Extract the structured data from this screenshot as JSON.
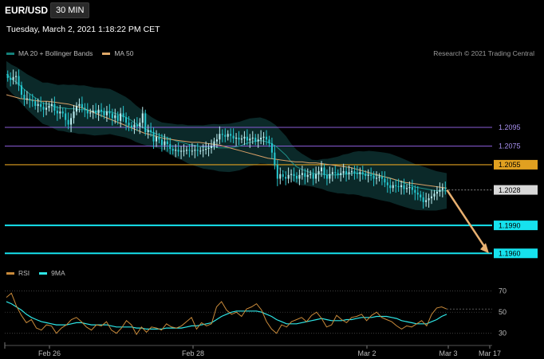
{
  "header": {
    "symbol": "EUR/USD",
    "interval": "30 MIN"
  },
  "datetime": "Tuesday, March 2, 2021 1:18:22 PM CET",
  "legend_top": [
    {
      "label": "MA 20 + Bollinger Bands",
      "color": "#14807a"
    },
    {
      "label": "MA 50",
      "color": "#e0a868"
    }
  ],
  "legend_rsi": [
    {
      "label": "RSI",
      "color": "#c98a3a"
    },
    {
      "label": "9MA",
      "color": "#2ee6e6"
    }
  ],
  "credit": "Research © 2021 Trading Central",
  "colors": {
    "up": "#bdeff2",
    "down": "#25c8d0",
    "level_gold": "#e0a020",
    "level_purple": "#8a5cd6",
    "level_cyan": "#16e2ee",
    "arrow": "#e8b070"
  },
  "chart_data": [
    {
      "type": "candlestick",
      "ylim": [
        1.195,
        1.2165
      ],
      "series": [
        {
          "name": "Price",
          "values": [
            1.2148,
            1.2146,
            1.2149,
            1.215,
            1.214,
            1.213,
            1.2125,
            1.2126,
            1.2124,
            1.2123,
            1.2118,
            1.212,
            1.2117,
            1.2114,
            1.2116,
            1.2118,
            1.212,
            1.2113,
            1.211,
            1.2112,
            1.211,
            1.2103,
            1.2098,
            1.2105,
            1.2112,
            1.2118,
            1.212,
            1.2116,
            1.2114,
            1.211,
            1.2111,
            1.2113,
            1.211,
            1.2114,
            1.2112,
            1.2108,
            1.2112,
            1.211,
            1.2105,
            1.2108,
            1.2102,
            1.211,
            1.2106,
            1.21,
            1.2097,
            1.2095,
            1.2098,
            1.2096,
            1.21,
            1.211,
            1.209,
            1.2092,
            1.209,
            1.208,
            1.2085,
            1.2082,
            1.2076,
            1.208,
            1.2077,
            1.2072,
            1.207,
            1.2071,
            1.2069,
            1.207,
            1.207,
            1.2071,
            1.207,
            1.207,
            1.2071,
            1.207,
            1.207,
            1.2071,
            1.2072,
            1.2073,
            1.2075,
            1.208,
            1.2082,
            1.2088,
            1.2087,
            1.2085,
            1.2088,
            1.2086,
            1.2083,
            1.2084,
            1.2082,
            1.2083,
            1.2085,
            1.2081,
            1.2083,
            1.2084,
            1.208,
            1.2082,
            1.2084,
            1.2085,
            1.2082,
            1.2078,
            1.2068,
            1.2055,
            1.204,
            1.2045,
            1.2042,
            1.204,
            1.2044,
            1.2045,
            1.2043,
            1.204,
            1.2044,
            1.2046,
            1.2042,
            1.2044,
            1.2045,
            1.204,
            1.2045,
            1.2048,
            1.2052,
            1.2044,
            1.204,
            1.2045,
            1.2047,
            1.2046,
            1.2044,
            1.2046,
            1.2048,
            1.2045,
            1.2047,
            1.2048,
            1.2046,
            1.2045,
            1.2047,
            1.2045,
            1.2043,
            1.2044,
            1.2043,
            1.204,
            1.2041,
            1.2042,
            1.204,
            1.2036,
            1.2033,
            1.203,
            1.2033,
            1.2032,
            1.2031,
            1.2033,
            1.2029,
            1.203,
            1.2031,
            1.2028,
            1.2025,
            1.2023,
            1.202,
            1.2015,
            1.2017,
            1.2019,
            1.2021,
            1.2024,
            1.2026,
            1.2028,
            1.203,
            1.2029
          ]
        },
        {
          "name": "MA 20",
          "values": [
            1.2152,
            1.2147,
            1.2143,
            1.2138,
            1.2133,
            1.2129,
            1.2125,
            1.2121,
            1.212,
            1.2118,
            1.2116,
            1.2116,
            1.2115,
            1.2115,
            1.2114,
            1.2114,
            1.2113,
            1.2112,
            1.2112,
            1.2112,
            1.2112,
            1.211,
            1.2108,
            1.2106,
            1.2103,
            1.2099,
            1.2096,
            1.2093,
            1.209,
            1.2088,
            1.2086,
            1.2084,
            1.2082,
            1.208,
            1.2079,
            1.2077,
            1.2076,
            1.2075,
            1.2074,
            1.2074,
            1.2074,
            1.2073,
            1.2073,
            1.2073,
            1.2074,
            1.2075,
            1.2077,
            1.2079,
            1.208,
            1.2081,
            1.208,
            1.2078,
            1.2075,
            1.207,
            1.2065,
            1.2058,
            1.2053,
            1.205,
            1.2048,
            1.2046,
            1.2045,
            1.2045,
            1.2044,
            1.2044,
            1.2044,
            1.2045,
            1.2045,
            1.2046,
            1.2046,
            1.2045,
            1.2045,
            1.2044,
            1.2043,
            1.2042,
            1.2041,
            1.2039,
            1.2037,
            1.2035,
            1.2033,
            1.2031,
            1.203,
            1.2029,
            1.2028,
            1.2027,
            1.2027,
            1.2027
          ]
        },
        {
          "name": "MA 50",
          "values": [
            1.213,
            1.2128,
            1.2126,
            1.2125,
            1.2124,
            1.2123,
            1.2123,
            1.2122,
            1.2121,
            1.212,
            1.2118,
            1.2116,
            1.2113,
            1.211,
            1.2107,
            1.2104,
            1.2101,
            1.2098,
            1.2095,
            1.2092,
            1.2089,
            1.2087,
            1.2085,
            1.2083,
            1.2082,
            1.2081,
            1.208,
            1.2079,
            1.2079,
            1.2078,
            1.2077,
            1.2076,
            1.2074,
            1.2072,
            1.207,
            1.2068,
            1.2066,
            1.2064,
            1.2062,
            1.2061,
            1.206,
            1.2059,
            1.2058,
            1.2058,
            1.2057,
            1.2057,
            1.2056,
            1.2055,
            1.2054,
            1.2053,
            1.2052,
            1.205,
            1.2048,
            1.2046,
            1.2044,
            1.2042,
            1.204,
            1.2038,
            1.2036,
            1.2035,
            1.2034,
            1.2033,
            1.2032,
            1.2031,
            1.203
          ]
        }
      ],
      "levels": [
        {
          "value": 1.2095,
          "label": "1.2095",
          "style": "purple"
        },
        {
          "value": 1.2075,
          "label": "1.2075",
          "style": "purple"
        },
        {
          "value": 1.2055,
          "label": "1.2055",
          "style": "gold"
        },
        {
          "value": 1.2028,
          "label": "1.2028",
          "style": "current"
        },
        {
          "value": 1.199,
          "label": "1.1990",
          "style": "cyan"
        },
        {
          "value": 1.196,
          "label": "1.1960",
          "style": "cyan"
        }
      ],
      "forecast_arrow": {
        "from": 1.2028,
        "to": 1.196
      }
    },
    {
      "type": "line",
      "ylim": [
        20,
        78
      ],
      "yticks": [
        70,
        50,
        30
      ],
      "series": [
        {
          "name": "RSI",
          "values": [
            64,
            68,
            56,
            47,
            40,
            43,
            35,
            33,
            38,
            37,
            30,
            35,
            38,
            43,
            45,
            41,
            36,
            33,
            38,
            37,
            41,
            33,
            30,
            35,
            42,
            38,
            29,
            36,
            31,
            36,
            35,
            33,
            39,
            36,
            35,
            37,
            41,
            45,
            34,
            40,
            37,
            39,
            55,
            60,
            52,
            48,
            50,
            46,
            53,
            55,
            58,
            52,
            41,
            34,
            30,
            38,
            36,
            41,
            43,
            45,
            41,
            47,
            50,
            44,
            36,
            38,
            47,
            43,
            40,
            45,
            46,
            48,
            42,
            47,
            50,
            45,
            43,
            41,
            37,
            34,
            37,
            36,
            39,
            42,
            37,
            48,
            54,
            55,
            53
          ]
        },
        {
          "name": "9MA",
          "values": [
            60,
            58,
            55,
            52,
            48,
            45,
            43,
            41,
            40,
            39,
            38,
            38,
            38,
            39,
            40,
            40,
            39,
            38,
            38,
            38,
            38,
            37,
            36,
            36,
            36,
            36,
            35,
            35,
            34,
            34,
            34,
            34,
            35,
            35,
            35,
            35,
            36,
            37,
            37,
            38,
            39,
            40,
            43,
            46,
            48,
            50,
            51,
            51,
            51,
            51,
            51,
            50,
            48,
            46,
            43,
            41,
            39,
            39,
            39,
            40,
            41,
            42,
            43,
            44,
            43,
            42,
            42,
            42,
            43,
            43,
            44,
            45,
            45,
            45,
            46,
            46,
            46,
            45,
            44,
            42,
            41,
            40,
            39,
            39,
            39,
            41,
            43,
            46,
            48
          ]
        }
      ]
    }
  ],
  "x_axis": {
    "labels": [
      "Feb 26",
      "Feb 28",
      "Mar 2",
      "Mar 3",
      "Mar 17"
    ]
  }
}
